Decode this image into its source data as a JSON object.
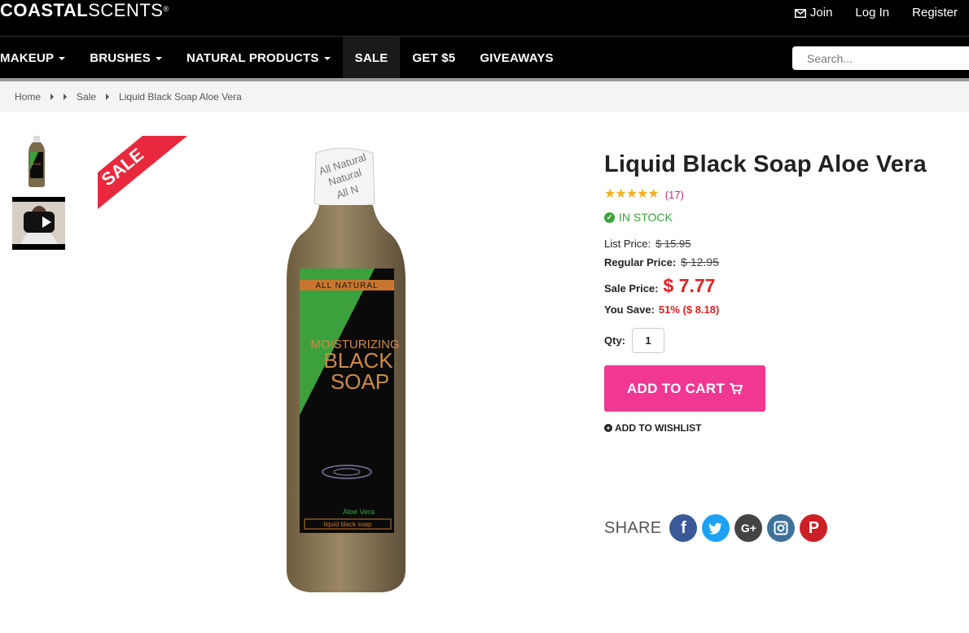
{
  "header": {
    "logo_bold": "COASTAL",
    "logo_light": "SCENTS",
    "logo_mark": "®",
    "links": {
      "join": "Join",
      "login": "Log In",
      "register": "Register"
    }
  },
  "nav": {
    "items": [
      {
        "label": "MAKEUP"
      },
      {
        "label": "BRUSHES"
      },
      {
        "label": "NATURAL PRODUCTS"
      },
      {
        "label": "SALE"
      },
      {
        "label": "GET $5"
      },
      {
        "label": "GIVEAWAYS"
      }
    ],
    "search_placeholder": "Search..."
  },
  "breadcrumb": {
    "home": "Home",
    "sale": "Sale",
    "current": "Liquid Black Soap Aloe Vera"
  },
  "ribbon": {
    "label": "SALE"
  },
  "bottle": {
    "cap_lines": [
      "All Natural",
      "Natural",
      "All N"
    ],
    "band": "ALL NATURAL",
    "line1": "MOISTURIZING",
    "line2": "BLACK",
    "line3": "SOAP",
    "variant": "Aloe Vera",
    "sub": "liquid black soap"
  },
  "product": {
    "title": "Liquid Black Soap Aloe Vera",
    "rating_count": "(17)",
    "stock": "IN STOCK",
    "list_price_label": "List Price:",
    "list_price": "$ 15.95",
    "regular_price_label": "Regular Price:",
    "regular_price": "$ 12.95",
    "sale_price_label": "Sale Price:",
    "sale_price": "$ 7.77",
    "you_save_label": "You Save:",
    "you_save": "51% ($ 8.18)",
    "qty_label": "Qty:",
    "qty_value": "1",
    "add_to_cart": "ADD TO CART",
    "wishlist": "ADD TO WISHLIST",
    "share_label": "SHARE"
  },
  "colors": {
    "accent": "#f03893",
    "sale_red": "#e02020",
    "in_stock": "#3aa43a",
    "rating": "#f0b020",
    "facebook": "#3b5998",
    "twitter": "#1da1f2",
    "googleplus": "#444444",
    "instagram": "#3f729b",
    "pinterest": "#cb2027"
  }
}
